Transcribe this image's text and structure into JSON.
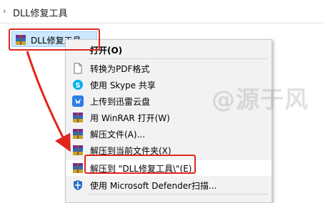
{
  "breadcrumb": {
    "folder": "DLL修复工具",
    "chevron": "›"
  },
  "file": {
    "name": "DLL修复工具.zip",
    "visible_label": "DLL修复工具"
  },
  "menu": {
    "items": [
      {
        "id": "open",
        "icon": "none",
        "label": "打开(O)",
        "bold": true
      },
      {
        "id": "convert-pdf",
        "icon": "document-icon",
        "label": "转换为PDF格式"
      },
      {
        "id": "skype-share",
        "icon": "skype-icon",
        "label": "使用 Skype 共享"
      },
      {
        "id": "xunlei-upload",
        "icon": "xunlei-icon",
        "label": "上传到迅雷云盘"
      },
      {
        "id": "winrar-open",
        "icon": "winrar-icon",
        "label": "用 WinRAR 打开(W)"
      },
      {
        "id": "extract-files",
        "icon": "winrar-icon",
        "label": "解压文件(A)..."
      },
      {
        "id": "extract-here",
        "icon": "winrar-icon",
        "label": "解压到当前文件夹(X)"
      },
      {
        "id": "extract-to-folder",
        "icon": "winrar-icon",
        "label": "解压到 \"DLL修复工具\\\"(E)"
      },
      {
        "id": "defender-scan",
        "icon": "defender-icon",
        "label": "使用 Microsoft Defender扫描..."
      }
    ]
  },
  "watermark": "@源于风",
  "colors": {
    "annotation_red": "#e0261b",
    "selection_blue": "#cce8ff",
    "menu_bg": "#f2f2f2"
  }
}
